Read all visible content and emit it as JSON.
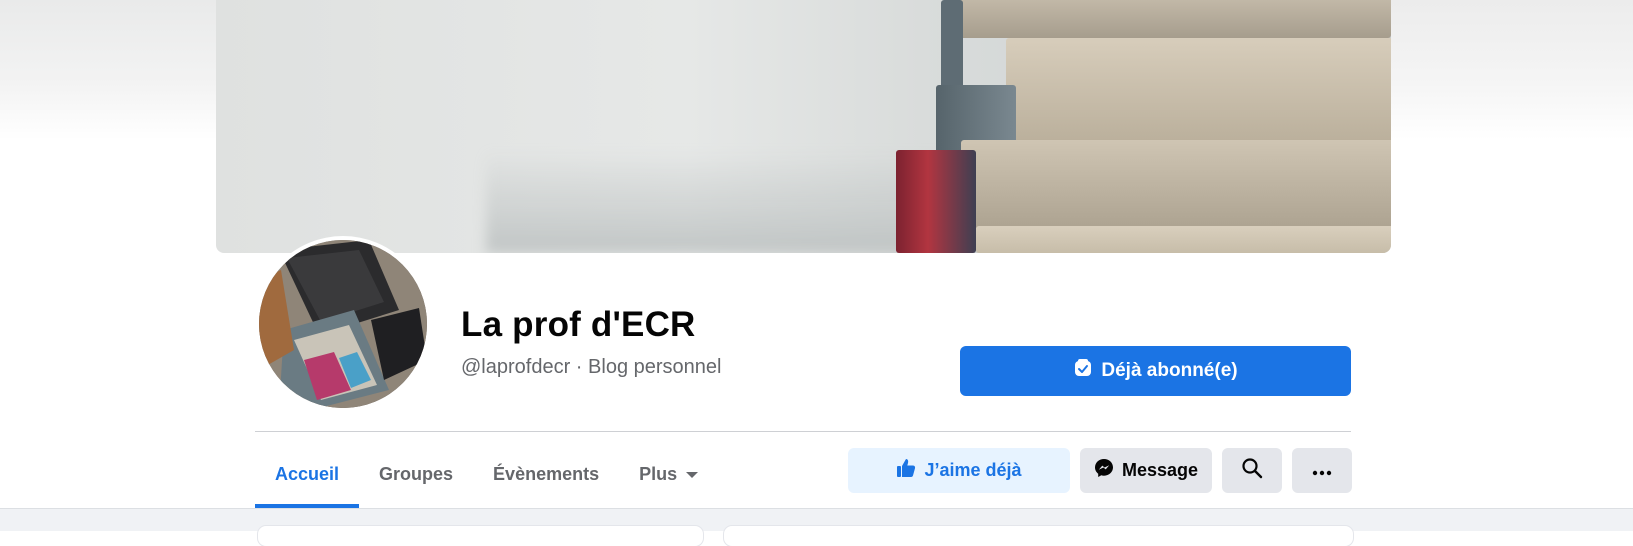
{
  "page": {
    "name": "La prof d'ECR",
    "username": "@laprofdecr",
    "separator": " · ",
    "category": "Blog personnel"
  },
  "follow_button": {
    "label": "Déjà abonné(e)",
    "icon": "following-icon"
  },
  "tabs": [
    {
      "label": "Accueil",
      "active": true
    },
    {
      "label": "Groupes",
      "active": false
    },
    {
      "label": "Évènements",
      "active": false
    },
    {
      "label": "Plus",
      "active": false,
      "icon": "caret-down-icon"
    }
  ],
  "actions": {
    "like_label": "J’aime déjà",
    "like_icon": "thumbs-up-icon",
    "message_label": "Message",
    "message_icon": "messenger-icon",
    "search_icon": "search-icon",
    "more_icon": "ellipsis-icon"
  },
  "colors": {
    "accent": "#1b74e4",
    "like_bg": "#e7f3ff",
    "secondary_bg": "#e4e6eb",
    "text": "#050505",
    "muted": "#65676b"
  }
}
